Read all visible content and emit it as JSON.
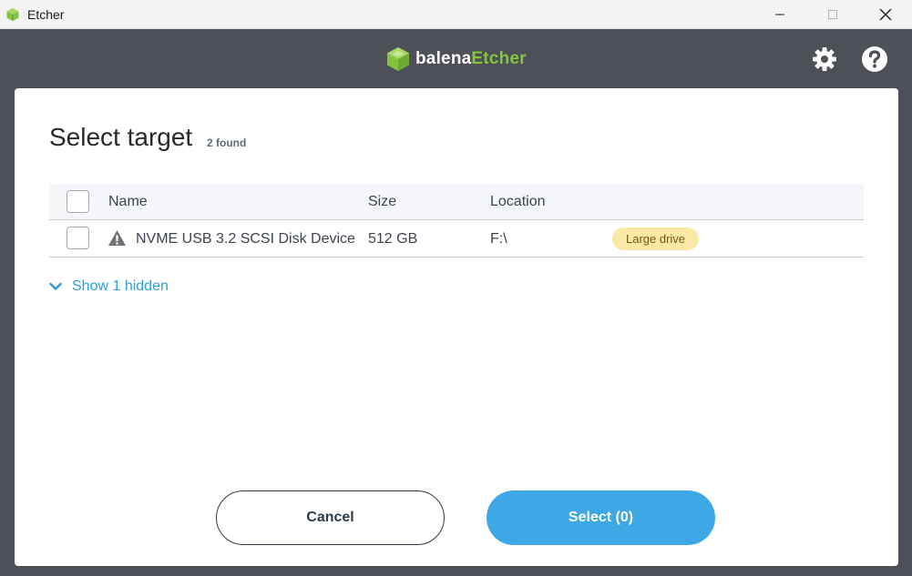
{
  "window": {
    "title": "Etcher"
  },
  "header": {
    "brand_primary": "balena",
    "brand_secondary": "Etcher",
    "brand_color": "#85c441"
  },
  "modal": {
    "title": "Select target",
    "count": "2 found",
    "columns": {
      "name": "Name",
      "size": "Size",
      "location": "Location"
    },
    "drives": [
      {
        "name": "NVME USB 3.2 SCSI Disk Device",
        "size": "512 GB",
        "location": "F:\\",
        "badge": "Large drive",
        "status_icon": "warning-icon",
        "checked": false
      }
    ],
    "show_hidden": "Show 1 hidden",
    "cancel_label": "Cancel",
    "select_label": "Select (0)"
  },
  "colors": {
    "accent": "#3ea7e6",
    "link": "#2a9fd8",
    "header_bg": "#4d5057",
    "badge_bg": "#fbe8a5"
  }
}
